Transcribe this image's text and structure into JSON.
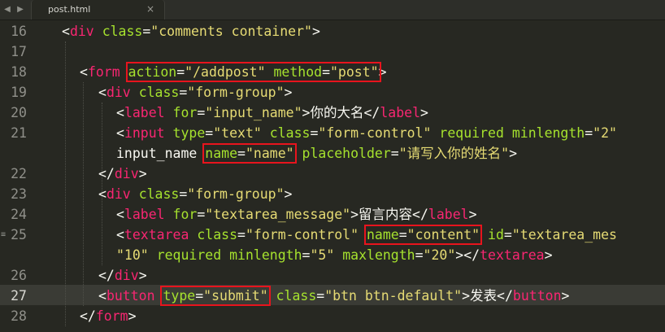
{
  "tab": {
    "title": "post.html",
    "close_glyph": "×"
  },
  "nav": {
    "back_glyph": "◀",
    "forward_glyph": "▶"
  },
  "line_numbers": [
    "16",
    "17",
    "18",
    "19",
    "20",
    "21",
    "",
    "22",
    "23",
    "24",
    "25",
    "",
    "26",
    "27",
    "28"
  ],
  "active_line": "27",
  "theme": {
    "background": "#272822",
    "tag": "#f92672",
    "attr": "#a6e22e",
    "string": "#e6db74",
    "text": "#f8f8f2",
    "highlight_box": "#e8141d"
  },
  "lines": [
    {
      "tokens": [
        {
          "t": "<",
          "k": "tx"
        },
        {
          "t": "div",
          "k": "tg"
        },
        {
          "t": " ",
          "k": "tx"
        },
        {
          "t": "class",
          "k": "at"
        },
        {
          "t": "=",
          "k": "tx"
        },
        {
          "t": "\"comments container\"",
          "k": "st"
        },
        {
          "t": ">",
          "k": "tx"
        }
      ]
    },
    {
      "tokens": []
    },
    {
      "tokens": [
        {
          "t": "<",
          "k": "tx"
        },
        {
          "t": "form",
          "k": "tg"
        },
        {
          "t": " ",
          "k": "tx"
        },
        {
          "t": "action",
          "k": "at",
          "box": 1
        },
        {
          "t": "=",
          "k": "tx",
          "box": 1
        },
        {
          "t": "\"/addpost\"",
          "k": "st",
          "box": 1
        },
        {
          "t": " ",
          "k": "tx",
          "box": 1
        },
        {
          "t": "method",
          "k": "at",
          "box": 1
        },
        {
          "t": "=",
          "k": "tx",
          "box": 1
        },
        {
          "t": "\"post\"",
          "k": "st",
          "box": 1
        },
        {
          "t": ">",
          "k": "tx"
        }
      ]
    },
    {
      "tokens": [
        {
          "t": "<",
          "k": "tx"
        },
        {
          "t": "div",
          "k": "tg"
        },
        {
          "t": " ",
          "k": "tx"
        },
        {
          "t": "class",
          "k": "at"
        },
        {
          "t": "=",
          "k": "tx"
        },
        {
          "t": "\"form-group\"",
          "k": "st"
        },
        {
          "t": ">",
          "k": "tx"
        }
      ]
    },
    {
      "tokens": [
        {
          "t": "<",
          "k": "tx"
        },
        {
          "t": "label",
          "k": "tg"
        },
        {
          "t": " ",
          "k": "tx"
        },
        {
          "t": "for",
          "k": "at"
        },
        {
          "t": "=",
          "k": "tx"
        },
        {
          "t": "\"input_name\"",
          "k": "st"
        },
        {
          "t": ">你的大名</",
          "k": "tx"
        },
        {
          "t": "label",
          "k": "tg"
        },
        {
          "t": ">",
          "k": "tx"
        }
      ]
    },
    {
      "tokens": [
        {
          "t": "<",
          "k": "tx"
        },
        {
          "t": "input",
          "k": "tg"
        },
        {
          "t": " ",
          "k": "tx"
        },
        {
          "t": "type",
          "k": "at"
        },
        {
          "t": "=",
          "k": "tx"
        },
        {
          "t": "\"text\"",
          "k": "st"
        },
        {
          "t": " ",
          "k": "tx"
        },
        {
          "t": "class",
          "k": "at"
        },
        {
          "t": "=",
          "k": "tx"
        },
        {
          "t": "\"form-control\"",
          "k": "st"
        },
        {
          "t": " ",
          "k": "tx"
        },
        {
          "t": "required",
          "k": "at"
        },
        {
          "t": " ",
          "k": "tx"
        },
        {
          "t": "minlength",
          "k": "at"
        },
        {
          "t": "=",
          "k": "tx"
        },
        {
          "t": "\"2\"",
          "k": "st"
        }
      ]
    },
    {
      "tokens": [
        {
          "t": "input_name",
          "k": "tx"
        },
        {
          "t": " ",
          "k": "tx"
        },
        {
          "t": "name",
          "k": "at",
          "box": 2
        },
        {
          "t": "=",
          "k": "tx",
          "box": 2
        },
        {
          "t": "\"name\"",
          "k": "st",
          "box": 2
        },
        {
          "t": " ",
          "k": "tx"
        },
        {
          "t": "placeholder",
          "k": "at"
        },
        {
          "t": "=",
          "k": "tx"
        },
        {
          "t": "\"请写入你的姓名\"",
          "k": "st"
        },
        {
          "t": ">",
          "k": "tx"
        }
      ]
    },
    {
      "tokens": [
        {
          "t": "</",
          "k": "tx"
        },
        {
          "t": "div",
          "k": "tg"
        },
        {
          "t": ">",
          "k": "tx"
        }
      ]
    },
    {
      "tokens": [
        {
          "t": "<",
          "k": "tx"
        },
        {
          "t": "div",
          "k": "tg"
        },
        {
          "t": " ",
          "k": "tx"
        },
        {
          "t": "class",
          "k": "at"
        },
        {
          "t": "=",
          "k": "tx"
        },
        {
          "t": "\"form-group\"",
          "k": "st"
        },
        {
          "t": ">",
          "k": "tx"
        }
      ]
    },
    {
      "tokens": [
        {
          "t": "<",
          "k": "tx"
        },
        {
          "t": "label",
          "k": "tg"
        },
        {
          "t": " ",
          "k": "tx"
        },
        {
          "t": "for",
          "k": "at"
        },
        {
          "t": "=",
          "k": "tx"
        },
        {
          "t": "\"textarea_message\"",
          "k": "st"
        },
        {
          "t": ">留言内容</",
          "k": "tx"
        },
        {
          "t": "label",
          "k": "tg"
        },
        {
          "t": ">",
          "k": "tx"
        }
      ]
    },
    {
      "tokens": [
        {
          "t": "<",
          "k": "tx"
        },
        {
          "t": "textarea",
          "k": "tg"
        },
        {
          "t": " ",
          "k": "tx"
        },
        {
          "t": "class",
          "k": "at"
        },
        {
          "t": "=",
          "k": "tx"
        },
        {
          "t": "\"form-control\"",
          "k": "st"
        },
        {
          "t": " ",
          "k": "tx"
        },
        {
          "t": "name",
          "k": "at",
          "box": 3
        },
        {
          "t": "=",
          "k": "tx",
          "box": 3
        },
        {
          "t": "\"content\"",
          "k": "st",
          "box": 3
        },
        {
          "t": " ",
          "k": "tx"
        },
        {
          "t": "id",
          "k": "at"
        },
        {
          "t": "=",
          "k": "tx"
        },
        {
          "t": "\"textarea_mes",
          "k": "st"
        }
      ]
    },
    {
      "tokens": [
        {
          "t": "\"10\"",
          "k": "st"
        },
        {
          "t": " ",
          "k": "tx"
        },
        {
          "t": "required",
          "k": "at"
        },
        {
          "t": " ",
          "k": "tx"
        },
        {
          "t": "minlength",
          "k": "at"
        },
        {
          "t": "=",
          "k": "tx"
        },
        {
          "t": "\"5\"",
          "k": "st"
        },
        {
          "t": " ",
          "k": "tx"
        },
        {
          "t": "maxlength",
          "k": "at"
        },
        {
          "t": "=",
          "k": "tx"
        },
        {
          "t": "\"20\"",
          "k": "st"
        },
        {
          "t": "></",
          "k": "tx"
        },
        {
          "t": "textarea",
          "k": "tg"
        },
        {
          "t": ">",
          "k": "tx"
        }
      ]
    },
    {
      "tokens": [
        {
          "t": "</",
          "k": "tx"
        },
        {
          "t": "div",
          "k": "tg"
        },
        {
          "t": ">",
          "k": "tx"
        }
      ]
    },
    {
      "tokens": [
        {
          "t": "<",
          "k": "tx"
        },
        {
          "t": "button",
          "k": "tg"
        },
        {
          "t": " ",
          "k": "tx"
        },
        {
          "t": "type",
          "k": "at",
          "box": 4
        },
        {
          "t": "=",
          "k": "tx",
          "box": 4
        },
        {
          "t": "\"submit\"",
          "k": "st",
          "box": 4
        },
        {
          "t": " ",
          "k": "tx"
        },
        {
          "t": "class",
          "k": "at"
        },
        {
          "t": "=",
          "k": "tx"
        },
        {
          "t": "\"btn btn-default\"",
          "k": "st"
        },
        {
          "t": ">发表</",
          "k": "tx"
        },
        {
          "t": "button",
          "k": "tg"
        },
        {
          "t": ">",
          "k": "tx"
        }
      ]
    },
    {
      "tokens": [
        {
          "t": "</",
          "k": "tx"
        },
        {
          "t": "form",
          "k": "tg"
        },
        {
          "t": ">",
          "k": "tx"
        }
      ]
    }
  ]
}
